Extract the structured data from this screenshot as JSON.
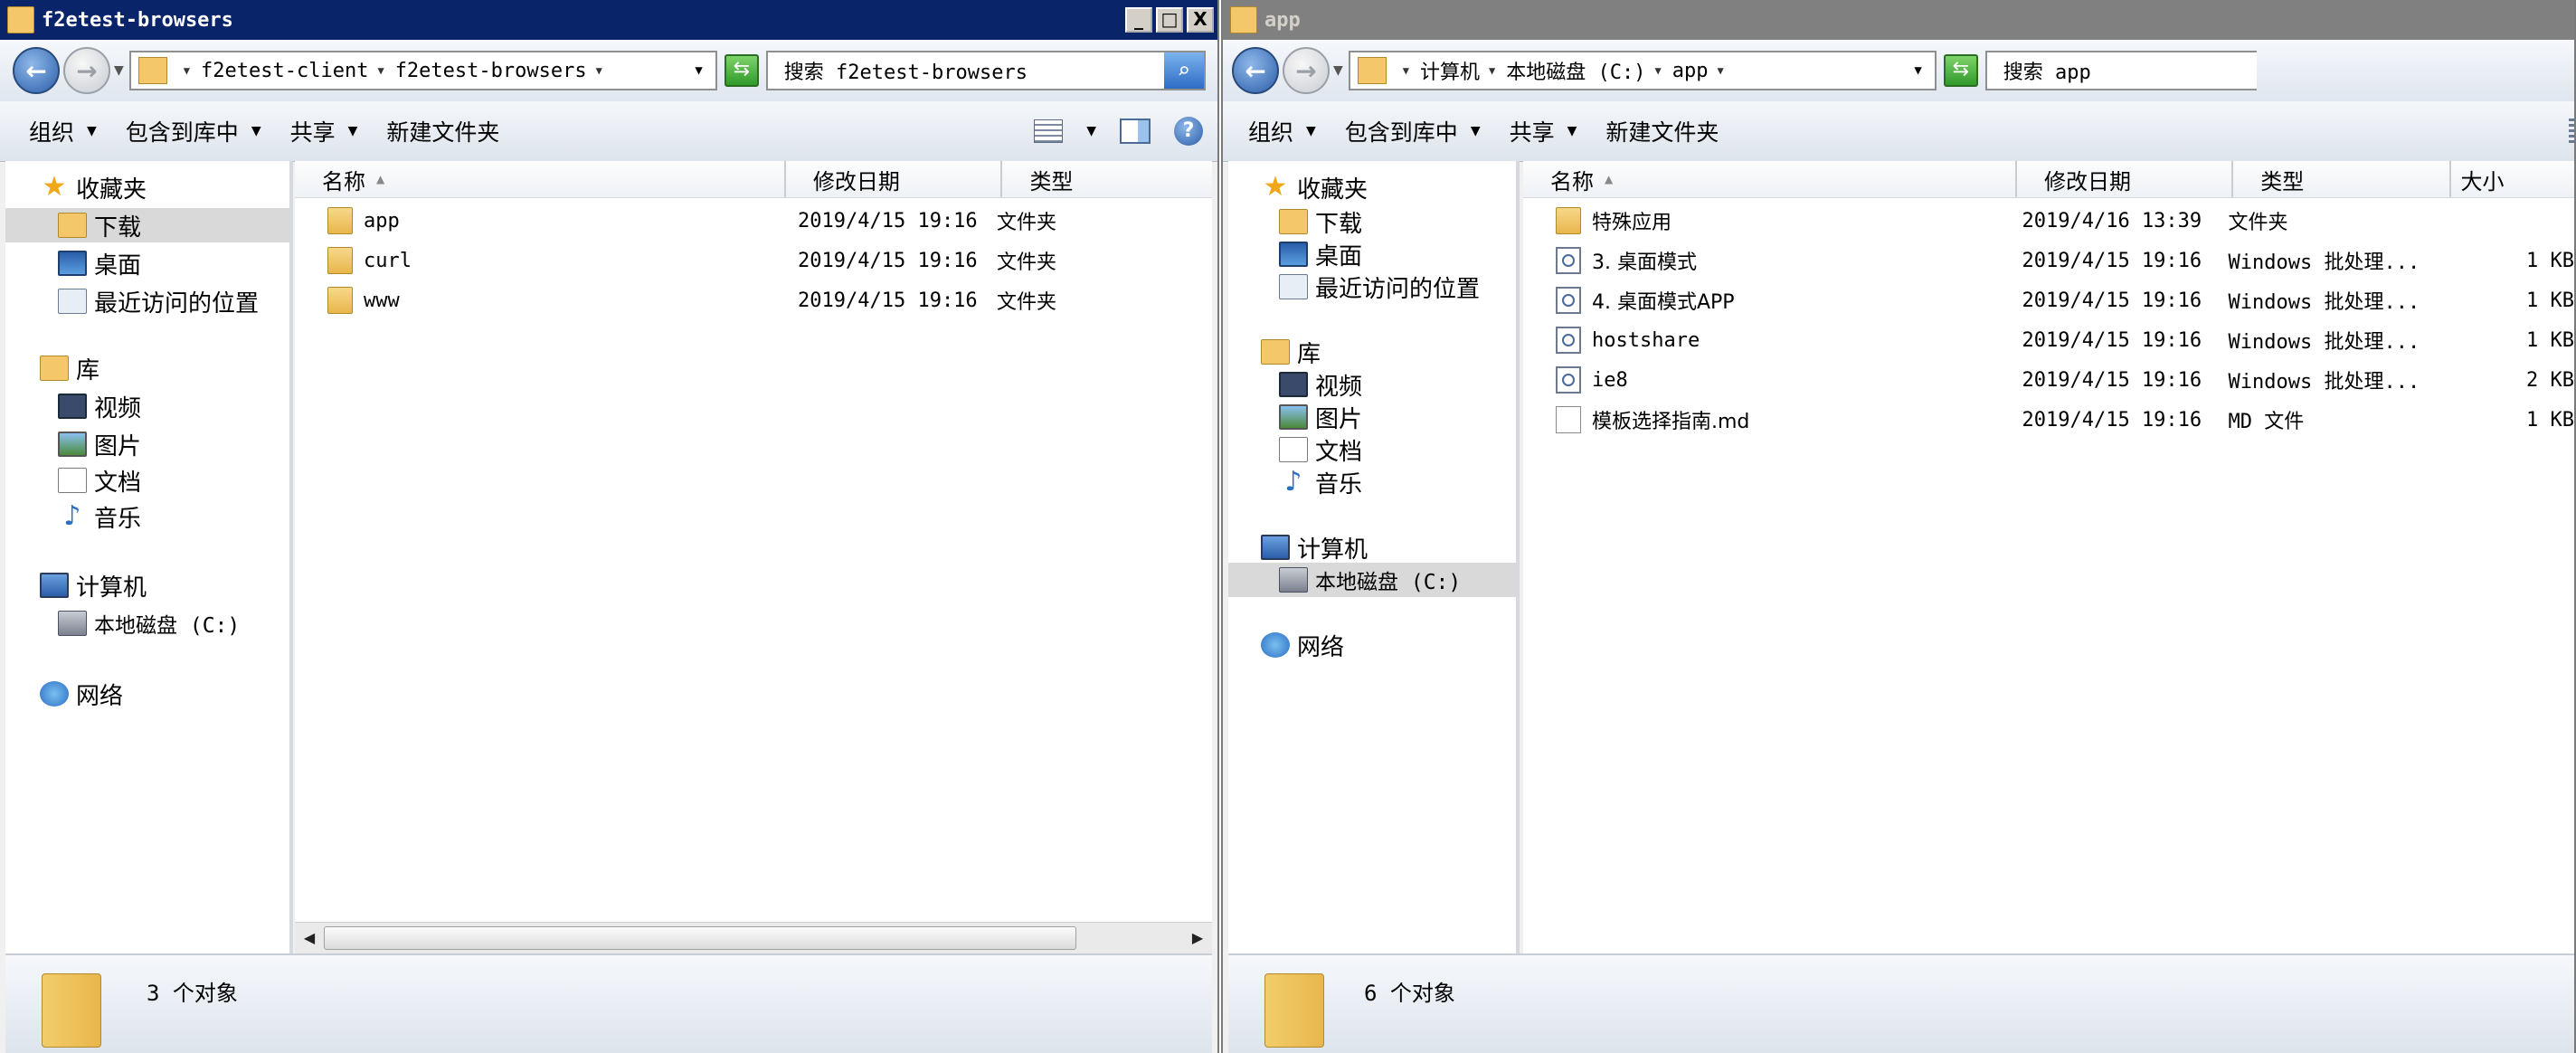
{
  "left_window": {
    "title": "f2etest-browsers",
    "caption_buttons": [
      "_",
      "□",
      "X"
    ],
    "breadcrumb": [
      "f2etest-client",
      "f2etest-browsers"
    ],
    "search_placeholder": "搜索 f2etest-browsers",
    "toolbar": {
      "organize": "组织",
      "include_in_library": "包含到库中",
      "share": "共享",
      "new_folder": "新建文件夹"
    },
    "nav": {
      "favorites": "收藏夹",
      "favorites_items": [
        "下载",
        "桌面",
        "最近访问的位置"
      ],
      "libraries": "库",
      "library_items": [
        "视频",
        "图片",
        "文档",
        "音乐"
      ],
      "computer": "计算机",
      "computer_items": [
        "本地磁盘 (C:)"
      ],
      "network": "网络"
    },
    "selected_nav": "下载",
    "columns": [
      "名称",
      "修改日期",
      "类型"
    ],
    "files": [
      {
        "name": "app",
        "date": "2019/4/15 19:16",
        "type": "文件夹",
        "icon": "folder-icon"
      },
      {
        "name": "curl",
        "date": "2019/4/15 19:16",
        "type": "文件夹",
        "icon": "folder-icon"
      },
      {
        "name": "www",
        "date": "2019/4/15 19:16",
        "type": "文件夹",
        "icon": "folder-icon"
      }
    ],
    "status": "3 个对象"
  },
  "right_window": {
    "title": "app",
    "breadcrumb": [
      "计算机",
      "本地磁盘 (C:)",
      "app"
    ],
    "search_placeholder": "搜索 app",
    "toolbar": {
      "organize": "组织",
      "include_in_library": "包含到库中",
      "share": "共享",
      "new_folder": "新建文件夹"
    },
    "nav": {
      "favorites": "收藏夹",
      "favorites_items": [
        "下载",
        "桌面",
        "最近访问的位置"
      ],
      "libraries": "库",
      "library_items": [
        "视频",
        "图片",
        "文档",
        "音乐"
      ],
      "computer": "计算机",
      "computer_items": [
        "本地磁盘 (C:)"
      ],
      "network": "网络"
    },
    "selected_nav": "本地磁盘 (C:)",
    "columns": [
      "名称",
      "修改日期",
      "类型",
      "大小"
    ],
    "files": [
      {
        "name": "特殊应用",
        "date": "2019/4/16 13:39",
        "type": "文件夹",
        "size": "",
        "icon": "folder-icon"
      },
      {
        "name": "3. 桌面模式",
        "date": "2019/4/15 19:16",
        "type": "Windows 批处理...",
        "size": "1 KB",
        "icon": "batch-file-icon"
      },
      {
        "name": "4. 桌面模式APP",
        "date": "2019/4/15 19:16",
        "type": "Windows 批处理...",
        "size": "1 KB",
        "icon": "batch-file-icon"
      },
      {
        "name": "hostshare",
        "date": "2019/4/15 19:16",
        "type": "Windows 批处理...",
        "size": "1 KB",
        "icon": "batch-file-icon"
      },
      {
        "name": "ie8",
        "date": "2019/4/15 19:16",
        "type": "Windows 批处理...",
        "size": "2 KB",
        "icon": "batch-file-icon"
      },
      {
        "name": "模板选择指南.md",
        "date": "2019/4/15 19:16",
        "type": "MD 文件",
        "size": "1 KB",
        "icon": "document-file-icon"
      }
    ],
    "status": "6 个对象"
  }
}
